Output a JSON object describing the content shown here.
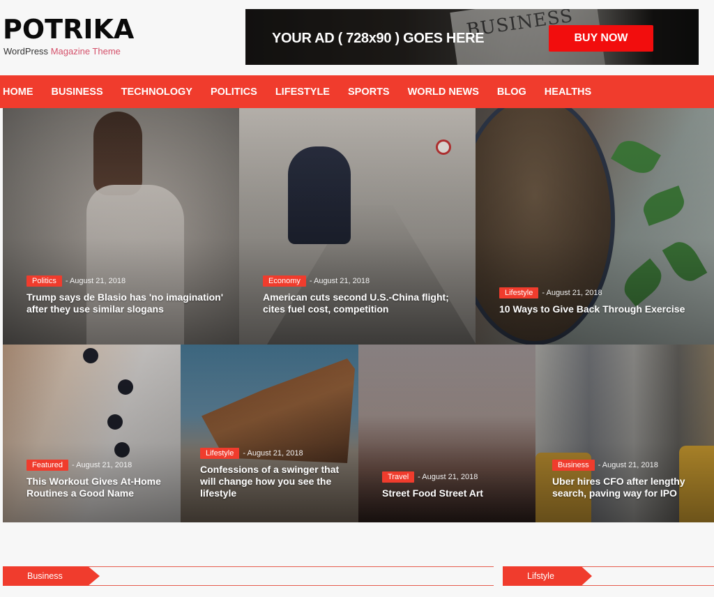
{
  "site": {
    "logo_title": "POTRIKA",
    "tagline_prefix": "WordPress",
    "tagline_accent": "Magazine Theme"
  },
  "ad": {
    "text": "YOUR AD ( 728x90 ) GOES HERE",
    "paper_word": "BUSINESS",
    "button_label": "BUY NOW"
  },
  "colors": {
    "accent": "#f03c2d",
    "ad_button": "#f20d0d",
    "tagline_accent": "#d4506a"
  },
  "nav": {
    "items": [
      "HOME",
      "BUSINESS",
      "TECHNOLOGY",
      "POLITICS",
      "LIFESTYLE",
      "SPORTS",
      "WORLD NEWS",
      "BLOG",
      "HEALTHS"
    ]
  },
  "featured_posts": [
    {
      "category": "Politics",
      "date": "August 21, 2018",
      "title": "Trump says de Blasio has 'no imagination' after they use similar slogans"
    },
    {
      "category": "Economy",
      "date": "August 21, 2018",
      "title": "American cuts second U.S.-China flight; cites fuel cost, competition"
    },
    {
      "category": "Lifestyle",
      "date": "August 21, 2018",
      "title": "10 Ways to Give Back Through Exercise"
    },
    {
      "category": "Featured",
      "date": "August 21, 2018",
      "title": "This Workout Gives At-Home Routines a Good Name"
    },
    {
      "category": "Lifestyle",
      "date": "August 21, 2018",
      "title": "Confessions of a swinger that will change how you see the lifestyle"
    },
    {
      "category": "Travel",
      "date": "August 21, 2018",
      "title": "Street Food Street Art"
    },
    {
      "category": "Business",
      "date": "August 21, 2018",
      "title": "Uber hires CFO after lengthy search, paving way for IPO"
    }
  ],
  "sections": [
    {
      "label": "Business"
    },
    {
      "label": "Lifstyle"
    }
  ]
}
